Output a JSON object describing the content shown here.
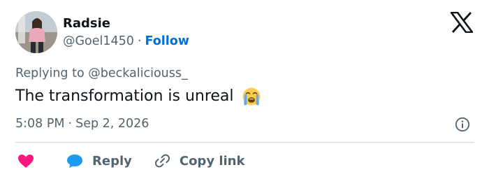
{
  "tweet": {
    "author": {
      "name": "Radsie",
      "handle": "@Goel1450",
      "separator": "·",
      "follow_label": "Follow"
    },
    "replying_to": "Replying to @beckaliciouss_",
    "text": "The transformation is unreal",
    "text_emoji": "loudly-crying-face",
    "time": "5:08 PM",
    "date_separator": "·",
    "date": "Sep 2, 2026"
  },
  "actions": {
    "reply_label": "Reply",
    "copy_link_label": "Copy link"
  },
  "icons": {
    "brand": "x-logo",
    "info": "info-icon",
    "like": "heart-icon",
    "reply": "speech-bubble-icon",
    "copy": "link-icon"
  },
  "colors": {
    "text": "#0f1419",
    "muted": "#536471",
    "link": "#006fd6",
    "heart": "#f91880",
    "reply_bubble": "#1d9bf0",
    "divider": "#cfd9de"
  }
}
